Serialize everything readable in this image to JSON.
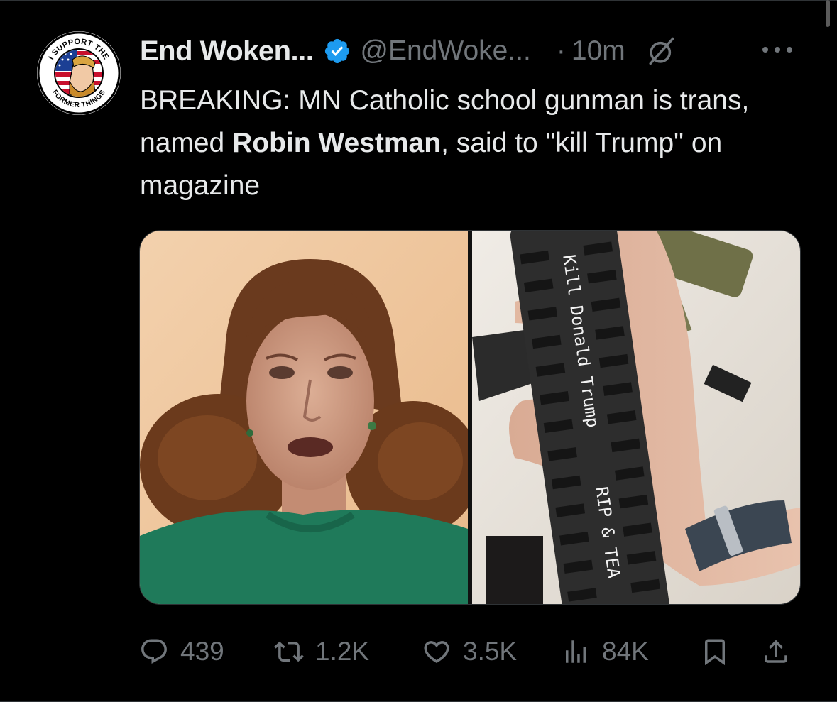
{
  "post": {
    "author_name": "End Woken...",
    "handle": "@EndWoke...",
    "separator": "·",
    "time": "10m",
    "more_label": "···",
    "text_parts": {
      "p1": "BREAKING: MN Catholic school gunman is trans, named ",
      "bold": "Robin Westman",
      "p2": ", said to \"kill Trump\" on magazine"
    },
    "avatar_text": {
      "top": "I SUPPORT THE",
      "bottom": "FORMER THINGS"
    },
    "media_text": {
      "line1": "Kill Donald Trump",
      "line2": "RIP & TEA"
    }
  },
  "actions": {
    "replies": "439",
    "reposts": "1.2K",
    "likes": "3.5K",
    "views": "84K"
  },
  "colors": {
    "background": "#000000",
    "text": "#e7e9ea",
    "muted": "#71767b",
    "verified": "#1d9bf0",
    "border": "#2f3336"
  },
  "icons": {
    "verified": "verified-badge-icon",
    "grok": "grok-icon",
    "reply": "reply-icon",
    "repost": "repost-icon",
    "like": "heart-icon",
    "views": "views-icon",
    "bookmark": "bookmark-icon",
    "share": "share-icon"
  }
}
